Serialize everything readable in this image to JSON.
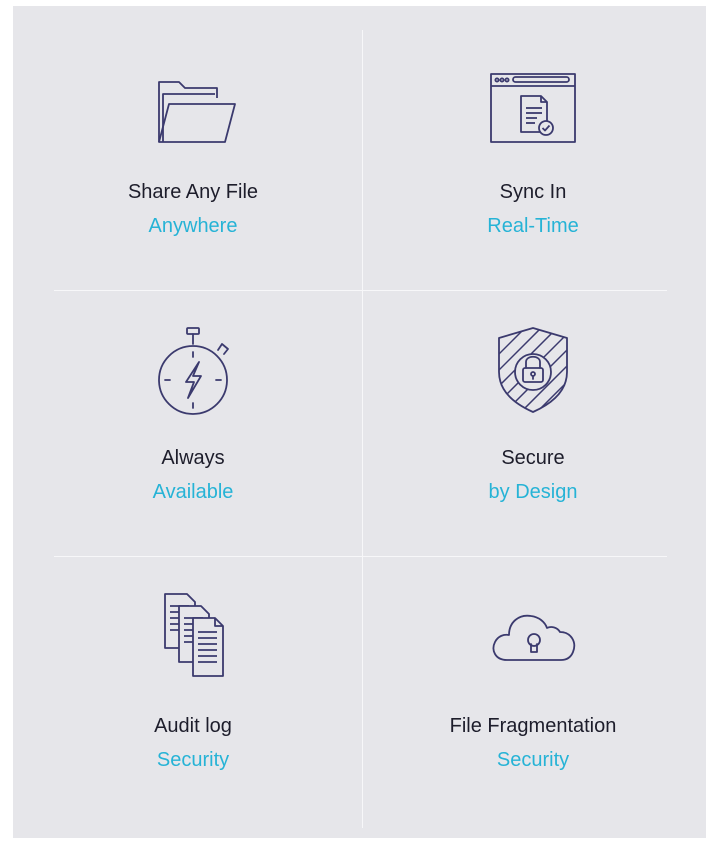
{
  "colors": {
    "panel_background": "#e6e6ea",
    "divider": "#f7f7f9",
    "title_text": "#1d1d2b",
    "accent_text": "#26b3d6",
    "icon_stroke": "#3b3a6e"
  },
  "features": [
    {
      "icon": "folder-icon",
      "title": "Share Any File",
      "subtitle": "Anywhere"
    },
    {
      "icon": "browser-document-icon",
      "title": "Sync In",
      "subtitle": "Real-Time"
    },
    {
      "icon": "stopwatch-icon",
      "title": "Always",
      "subtitle": "Available"
    },
    {
      "icon": "shield-lock-icon",
      "title": "Secure",
      "subtitle": "by Design"
    },
    {
      "icon": "documents-stack-icon",
      "title": "Audit log",
      "subtitle": "Security"
    },
    {
      "icon": "cloud-lock-icon",
      "title": "File Fragmentation",
      "subtitle": "Security"
    }
  ]
}
